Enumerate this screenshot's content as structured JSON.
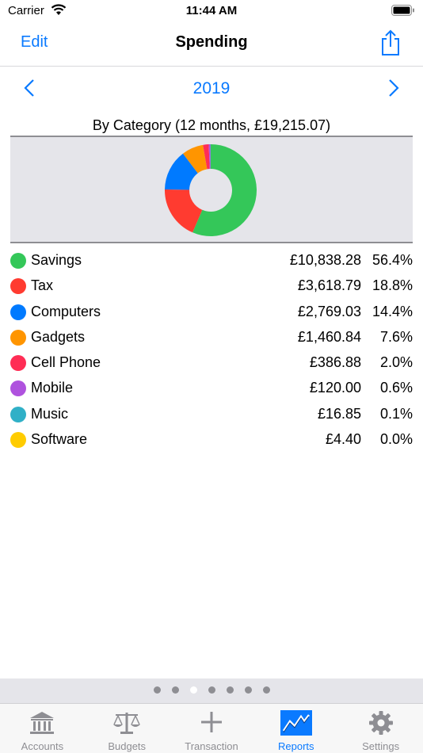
{
  "status_bar": {
    "carrier": "Carrier",
    "time": "11:44 AM"
  },
  "nav": {
    "edit_label": "Edit",
    "title": "Spending"
  },
  "period": {
    "year": "2019"
  },
  "chart": {
    "caption": "By Category (12 months, £19,215.07)"
  },
  "colors": {
    "accent": "#0a7aff",
    "inactive": "#8e8e93"
  },
  "categories": [
    {
      "name": "Savings",
      "amount": "£10,838.28",
      "percent": "56.4%",
      "share": 56.4,
      "color": "#34c759"
    },
    {
      "name": "Tax",
      "amount": "£3,618.79",
      "percent": "18.8%",
      "share": 18.8,
      "color": "#ff3b30"
    },
    {
      "name": "Computers",
      "amount": "£2,769.03",
      "percent": "14.4%",
      "share": 14.4,
      "color": "#007aff"
    },
    {
      "name": "Gadgets",
      "amount": "£1,460.84",
      "percent": "7.6%",
      "share": 7.6,
      "color": "#ff9500"
    },
    {
      "name": "Cell Phone",
      "amount": "£386.88",
      "percent": "2.0%",
      "share": 2.0,
      "color": "#ff2d55"
    },
    {
      "name": "Mobile",
      "amount": "£120.00",
      "percent": "0.6%",
      "share": 0.6,
      "color": "#af52de"
    },
    {
      "name": "Music",
      "amount": "£16.85",
      "percent": "0.1%",
      "share": 0.1,
      "color": "#30b0c7"
    },
    {
      "name": "Software",
      "amount": "£4.40",
      "percent": "0.0%",
      "share": 0.0,
      "color": "#ffcc00"
    }
  ],
  "pager": {
    "count": 7,
    "active_index": 2
  },
  "tabs": [
    {
      "label": "Accounts",
      "icon": "bank-icon",
      "active": false
    },
    {
      "label": "Budgets",
      "icon": "scales-icon",
      "active": false
    },
    {
      "label": "Transaction",
      "icon": "plus-icon",
      "active": false
    },
    {
      "label": "Reports",
      "icon": "chart-icon",
      "active": true
    },
    {
      "label": "Settings",
      "icon": "gear-icon",
      "active": false
    }
  ]
}
